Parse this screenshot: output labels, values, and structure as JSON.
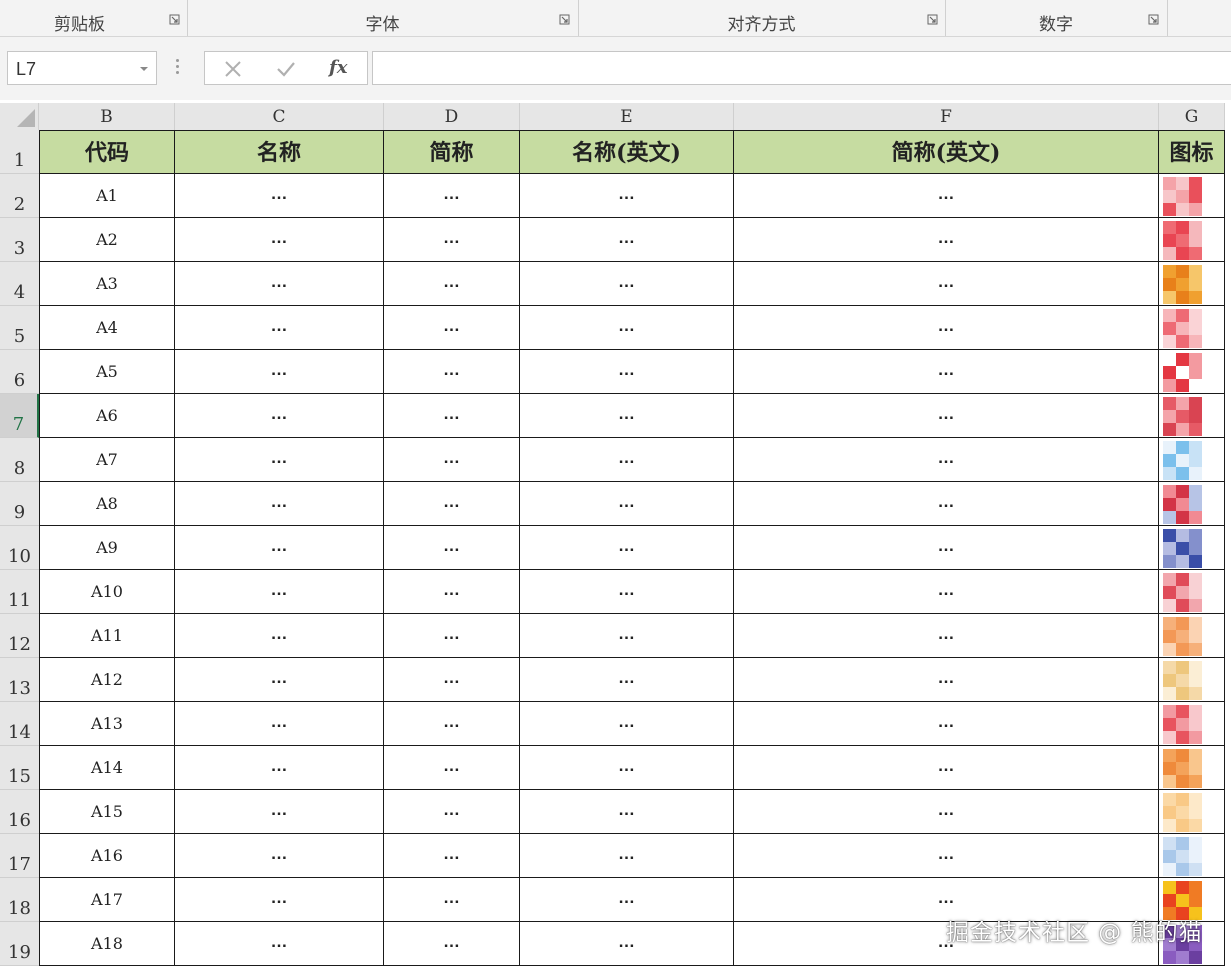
{
  "ribbon": {
    "groups": [
      "剪贴板",
      "字体",
      "对齐方式",
      "数字"
    ]
  },
  "formula_bar": {
    "name_box": "L7",
    "cancel_icon": "✕",
    "enter_icon": "✓",
    "fx_label": "fx",
    "formula": ""
  },
  "grid": {
    "columns": [
      "B",
      "C",
      "D",
      "E",
      "F",
      "G"
    ],
    "rows": [
      "1",
      "2",
      "3",
      "4",
      "5",
      "6",
      "7",
      "8",
      "9",
      "10",
      "11",
      "12",
      "13",
      "14",
      "15",
      "16",
      "17",
      "18",
      "19"
    ],
    "active_row": "7",
    "headers": [
      "代码",
      "名称",
      "简称",
      "名称(英文)",
      "简称(英文)",
      "图标"
    ],
    "data": [
      {
        "code": "A1",
        "name": "…",
        "short": "…",
        "name_en": "…",
        "short_en": "…"
      },
      {
        "code": "A2",
        "name": "…",
        "short": "…",
        "name_en": "…",
        "short_en": "…"
      },
      {
        "code": "A3",
        "name": "…",
        "short": "…",
        "name_en": "…",
        "short_en": "…"
      },
      {
        "code": "A4",
        "name": "…",
        "short": "…",
        "name_en": "…",
        "short_en": "…"
      },
      {
        "code": "A5",
        "name": "…",
        "short": "…",
        "name_en": "…",
        "short_en": "…"
      },
      {
        "code": "A6",
        "name": "…",
        "short": "…",
        "name_en": "…",
        "short_en": "…"
      },
      {
        "code": "A7",
        "name": "…",
        "short": "…",
        "name_en": "…",
        "short_en": "…"
      },
      {
        "code": "A8",
        "name": "…",
        "short": "…",
        "name_en": "…",
        "short_en": "…"
      },
      {
        "code": "A9",
        "name": "…",
        "short": "…",
        "name_en": "…",
        "short_en": "…"
      },
      {
        "code": "A10",
        "name": "…",
        "short": "…",
        "name_en": "…",
        "short_en": "…"
      },
      {
        "code": "A11",
        "name": "…",
        "short": "…",
        "name_en": "…",
        "short_en": "…"
      },
      {
        "code": "A12",
        "name": "…",
        "short": "…",
        "name_en": "…",
        "short_en": "…"
      },
      {
        "code": "A13",
        "name": "…",
        "short": "…",
        "name_en": "…",
        "short_en": "…"
      },
      {
        "code": "A14",
        "name": "…",
        "short": "…",
        "name_en": "…",
        "short_en": "…"
      },
      {
        "code": "A15",
        "name": "…",
        "short": "…",
        "name_en": "…",
        "short_en": "…"
      },
      {
        "code": "A16",
        "name": "…",
        "short": "…",
        "name_en": "…",
        "short_en": "…"
      },
      {
        "code": "A17",
        "name": "…",
        "short": "…",
        "name_en": "…",
        "short_en": "…"
      },
      {
        "code": "A18",
        "name": "…",
        "short": "…",
        "name_en": "…",
        "short_en": "…"
      }
    ],
    "icon_colors": [
      [
        "#f4a3a8",
        "#f7c6c9",
        "#e9505b"
      ],
      [
        "#ef6b73",
        "#e94552",
        "#f5b8bc"
      ],
      [
        "#f0a030",
        "#e8801a",
        "#f6c66a"
      ],
      [
        "#f7b5b9",
        "#ee6a74",
        "#fad3d6"
      ],
      [
        "#ffffff",
        "#e43742",
        "#f39aa0"
      ],
      [
        "#e65a66",
        "#f4a4aa",
        "#d94452"
      ],
      [
        "#e8f2fb",
        "#7cc0ec",
        "#c8e2f6"
      ],
      [
        "#f18a93",
        "#d33446",
        "#b7c4e6"
      ],
      [
        "#3a4ea8",
        "#b5bce2",
        "#8490cc"
      ],
      [
        "#f2a6ad",
        "#e04b59",
        "#f8d1d4"
      ],
      [
        "#f6b07a",
        "#f39856",
        "#fbd3b3"
      ],
      [
        "#f5d9a8",
        "#eec77d",
        "#fbeed5"
      ],
      [
        "#f29aa1",
        "#e8545f",
        "#f8c8cc"
      ],
      [
        "#f4a35a",
        "#ef8a3b",
        "#f9c68d"
      ],
      [
        "#fbd9a6",
        "#f9c986",
        "#fde9c9"
      ],
      [
        "#cfe0f3",
        "#a9c8ea",
        "#eaf2fb"
      ],
      [
        "#f6c21c",
        "#e9431f",
        "#f07b24"
      ],
      [
        "#6b3fa0",
        "#a07ccf",
        "#8a5cc0"
      ]
    ]
  },
  "watermark": "掘金技术社区 @ 熊的猫"
}
